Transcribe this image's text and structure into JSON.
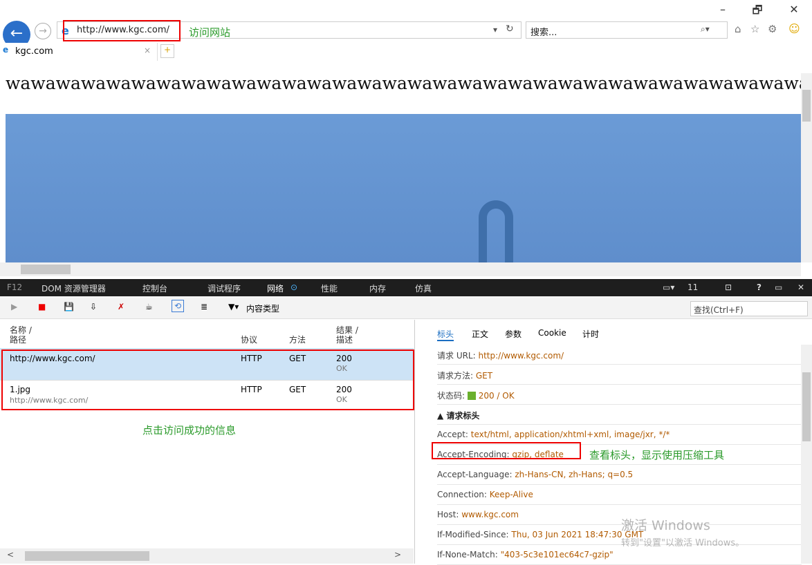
{
  "browser": {
    "url": "http://www.kgc.com/",
    "url_note": "访问网站",
    "search_placeholder": "搜索...",
    "tab_title": "kgc.com",
    "window_min": "–",
    "window_restore": "🗗",
    "window_close": "✕"
  },
  "page": {
    "heading": "wawawawawawawawawawawawawawawawawawawawawawawawawawawawawawawawawawawawaw",
    "image_color": "#6f9fd3"
  },
  "devtools": {
    "tabs": [
      "F12",
      "DOM 资源管理器",
      "控制台",
      "调试程序",
      "网络",
      "性能",
      "内存",
      "仿真"
    ],
    "active_tab": "网络",
    "error_count": "11",
    "content_type_label": "内容类型",
    "find_placeholder": "查找(Ctrl+F)"
  },
  "network": {
    "headers": {
      "name": "名称 /",
      "path": "路径",
      "protocol": "协议",
      "method": "方法",
      "result": "结果 /",
      "desc": "描述"
    },
    "rows": [
      {
        "name": "http://www.kgc.com/",
        "path": "",
        "protocol": "HTTP",
        "method": "GET",
        "status": "200",
        "text": "OK"
      },
      {
        "name": "1.jpg",
        "path": "http://www.kgc.com/",
        "protocol": "HTTP",
        "method": "GET",
        "status": "200",
        "text": "OK"
      }
    ],
    "note": "点击访问成功的信息"
  },
  "detail": {
    "tabs": [
      "标头",
      "正文",
      "参数",
      "Cookie",
      "计时"
    ],
    "request_url_label": "请求 URL:",
    "request_url": "http://www.kgc.com/",
    "method_label": "请求方法:",
    "method": "GET",
    "status_label": "状态码:",
    "status": "200 / OK",
    "section": "请求标头",
    "headers": [
      {
        "k": "Accept:",
        "v": "text/html, application/xhtml+xml, image/jxr, */*"
      },
      {
        "k": "Accept-Encoding:",
        "v": "gzip, deflate"
      },
      {
        "k": "Accept-Language:",
        "v": "zh-Hans-CN, zh-Hans; q=0.5"
      },
      {
        "k": "Connection:",
        "v": "Keep-Alive"
      },
      {
        "k": "Host:",
        "v": "www.kgc.com"
      },
      {
        "k": "If-Modified-Since:",
        "v": "Thu, 03 Jun 2021 18:47:30 GMT"
      },
      {
        "k": "If-None-Match:",
        "v": "\"403-5c3e101ec64c7-gzip\""
      }
    ],
    "note": "查看标头，显示使用压缩工具"
  },
  "watermark": {
    "line1": "激活 Windows",
    "line2": "转到\"设置\"以激活 Windows。"
  }
}
